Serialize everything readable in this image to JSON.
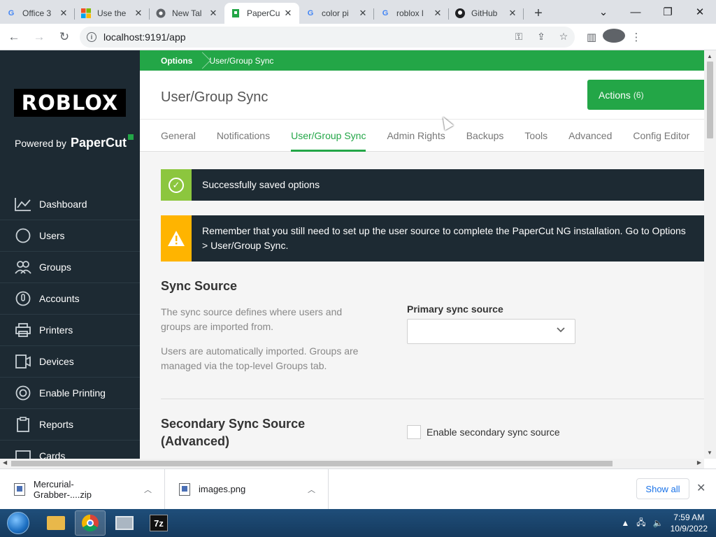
{
  "browser": {
    "tabs": [
      {
        "title": "Office 3",
        "active": false
      },
      {
        "title": "Use the",
        "active": false
      },
      {
        "title": "New Tal",
        "active": false
      },
      {
        "title": "PaperCu",
        "active": true
      },
      {
        "title": "color pi",
        "active": false
      },
      {
        "title": "roblox l",
        "active": false
      },
      {
        "title": "GitHub",
        "active": false
      }
    ],
    "url": "localhost:9191/app",
    "window_controls": {
      "minimize": "—",
      "maximize": "❐",
      "close": "✕",
      "tab_list": "⌄",
      "new_tab": "+"
    }
  },
  "sidebar": {
    "brand": "ROBLOX",
    "powered_by": "Powered by",
    "powered_brand": "PaperCut",
    "items": [
      {
        "label": "Dashboard",
        "icon": "chart-icon"
      },
      {
        "label": "Users",
        "icon": "user-icon"
      },
      {
        "label": "Groups",
        "icon": "group-icon"
      },
      {
        "label": "Accounts",
        "icon": "account-icon"
      },
      {
        "label": "Printers",
        "icon": "printer-icon"
      },
      {
        "label": "Devices",
        "icon": "device-icon"
      },
      {
        "label": "Enable Printing",
        "icon": "enable-printing-icon"
      },
      {
        "label": "Reports",
        "icon": "reports-icon"
      },
      {
        "label": "Cards",
        "icon": "cards-icon"
      }
    ]
  },
  "breadcrumb": {
    "parent": "Options",
    "current": "User/Group Sync"
  },
  "header": {
    "title": "User/Group Sync",
    "actions_label": "Actions",
    "actions_count": "(6)"
  },
  "tabs": [
    {
      "label": "General",
      "active": false
    },
    {
      "label": "Notifications",
      "active": false
    },
    {
      "label": "User/Group Sync",
      "active": true
    },
    {
      "label": "Admin Rights",
      "active": false
    },
    {
      "label": "Backups",
      "active": false
    },
    {
      "label": "Tools",
      "active": false
    },
    {
      "label": "Advanced",
      "active": false
    },
    {
      "label": "Config Editor",
      "active": false
    }
  ],
  "alerts": {
    "success": "Successfully saved options",
    "warning": "Remember that you still need to set up the user source to complete the PaperCut NG installation. Go to Options > User/Group Sync."
  },
  "sync_source": {
    "title": "Sync Source",
    "desc1": "The sync source defines where users and groups are imported from.",
    "desc2": "Users are automatically imported. Groups are managed via the top-level Groups tab.",
    "field_label": "Primary sync source",
    "selected_value": ""
  },
  "secondary": {
    "title": "Secondary Sync Source (Advanced)",
    "checkbox_label": "Enable secondary sync source",
    "checked": false
  },
  "downloads": {
    "items": [
      {
        "name": "Mercurial-Grabber-....zip"
      },
      {
        "name": "images.png"
      }
    ],
    "show_all": "Show all"
  },
  "taskbar": {
    "time": "7:59 AM",
    "date": "10/9/2022",
    "sevenzip": "7z"
  },
  "colors": {
    "accent": "#23a647",
    "sidebar": "#1d2a33",
    "success_icon": "#8cc63e",
    "warning_icon": "#ffb400"
  }
}
